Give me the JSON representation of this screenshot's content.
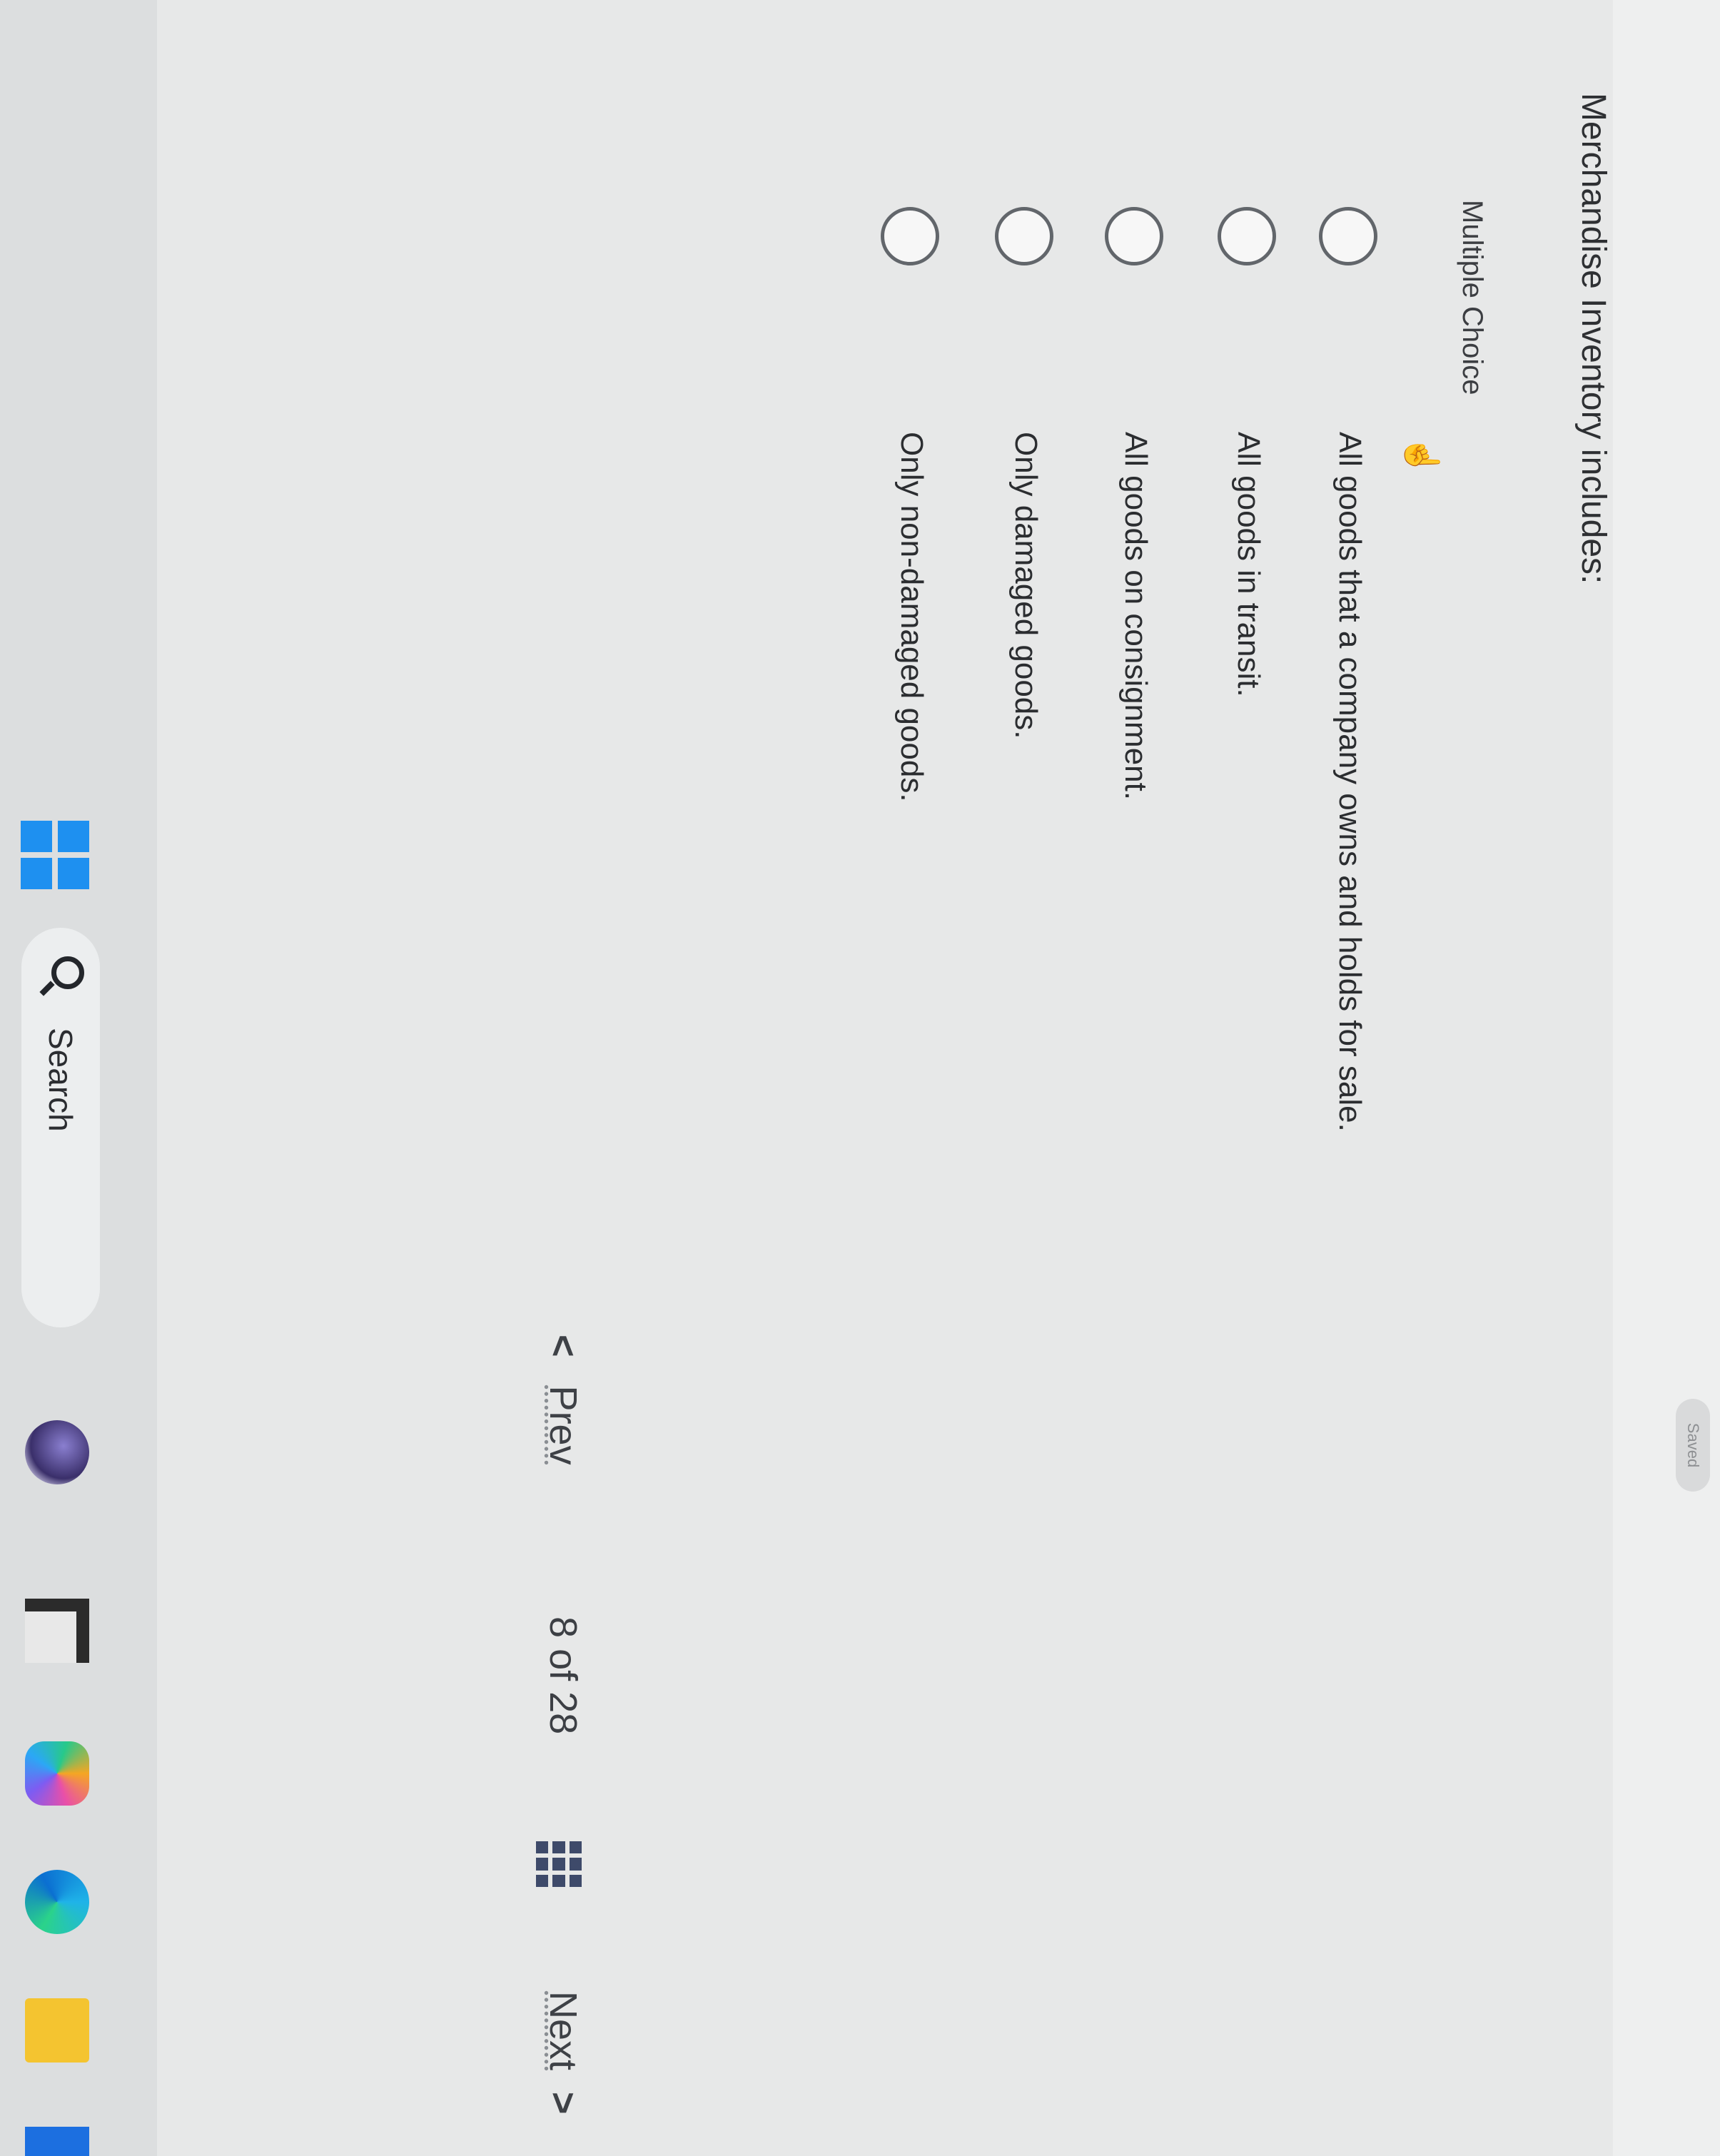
{
  "topbar": {
    "saved_label": "Saved"
  },
  "question": {
    "prompt": "Merchandise Inventory includes:",
    "type_label": "Multiple Choice",
    "choices": [
      "All goods that a company owns and holds for sale.",
      "All goods in transit.",
      "All goods on consignment.",
      "Only damaged goods.",
      "Only non-damaged goods."
    ]
  },
  "navigation": {
    "prev_label": "Prev",
    "counter_current": "8",
    "counter_of": "of",
    "counter_total": "28",
    "next_label": "Next"
  },
  "taskbar": {
    "search_label": "Search",
    "icons": [
      "windows-start-icon",
      "search-icon",
      "photo-app-icon",
      "file-explorer-icon",
      "copilot-icon",
      "edge-browser-icon",
      "folder-icon",
      "store-icon"
    ]
  },
  "colors": {
    "background": "#e7e8e8",
    "text": "#2e3033",
    "windows_blue": "#1e90f0",
    "grid_icon": "#3e4a6a"
  }
}
